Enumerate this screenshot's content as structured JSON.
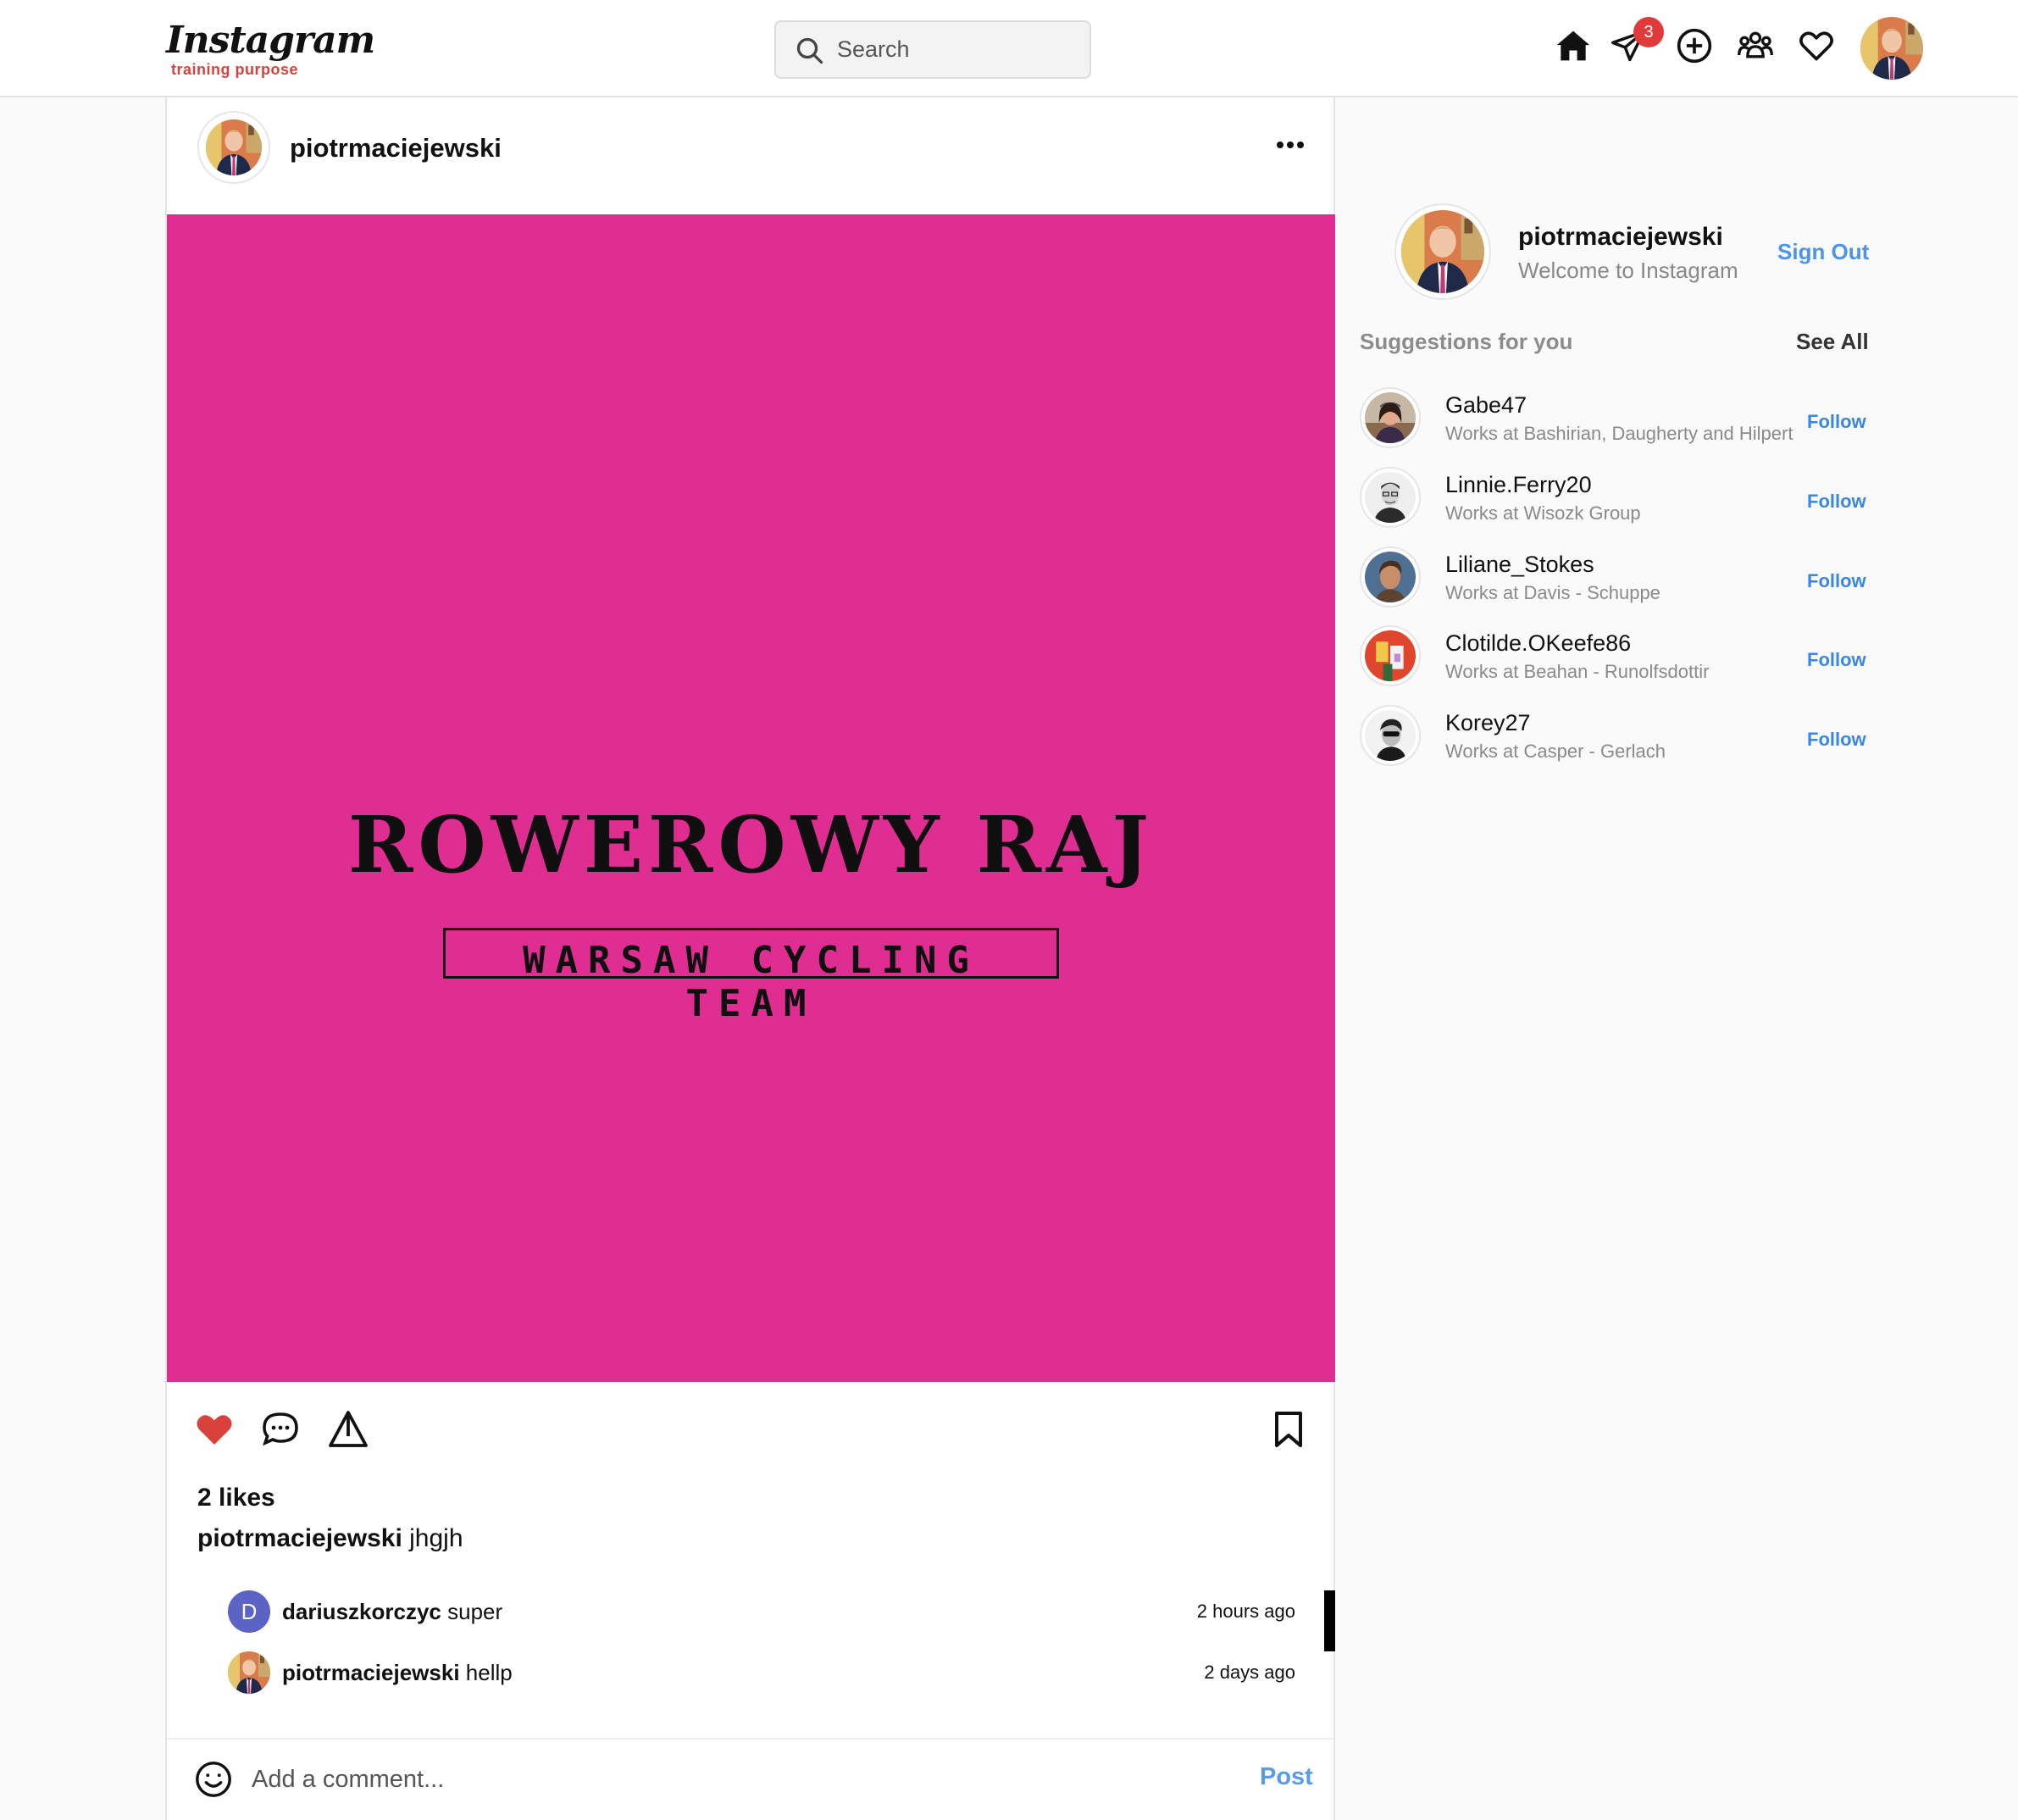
{
  "header": {
    "logo": "Instagram",
    "logo_sub": "training purpose",
    "search_placeholder": "Search",
    "notification_count": "3"
  },
  "post": {
    "username": "piotrmaciejewski",
    "image_title": "ROWEROWY RAJ",
    "image_subtitle": "WARSAW CYCLING TEAM",
    "image_bg": "#e02d91",
    "likes": "2 likes",
    "caption_user": "piotrmaciejewski",
    "caption_text": "jhgjh",
    "liked": true,
    "comments": [
      {
        "avatar_letter": "D",
        "user": "dariuszkorczyc",
        "text": "super",
        "time": "2 hours ago"
      },
      {
        "avatar_letter": "",
        "user": "piotrmaciejewski",
        "text": "hellp",
        "time": "2 days ago"
      }
    ],
    "add_comment_placeholder": "Add a comment...",
    "post_label": "Post"
  },
  "sidebar": {
    "username": "piotrmaciejewski",
    "welcome": "Welcome to Instagram",
    "sign_out": "Sign Out",
    "suggestions_title": "Suggestions for you",
    "see_all": "See All",
    "suggestions": [
      {
        "name": "Gabe47",
        "sub": "Works at Bashirian, Daugherty and Hilpert",
        "follow": "Follow"
      },
      {
        "name": "Linnie.Ferry20",
        "sub": "Works at Wisozk Group",
        "follow": "Follow"
      },
      {
        "name": "Liliane_Stokes",
        "sub": "Works at Davis - Schuppe",
        "follow": "Follow"
      },
      {
        "name": "Clotilde.OKeefe86",
        "sub": "Works at Beahan - Runolfsdottir",
        "follow": "Follow"
      },
      {
        "name": "Korey27",
        "sub": "Works at Casper - Gerlach",
        "follow": "Follow"
      }
    ]
  },
  "colors": {
    "accent_blue": "#3a86e4",
    "heart_red": "#d9423b",
    "badge_red": "#e03b3b"
  }
}
